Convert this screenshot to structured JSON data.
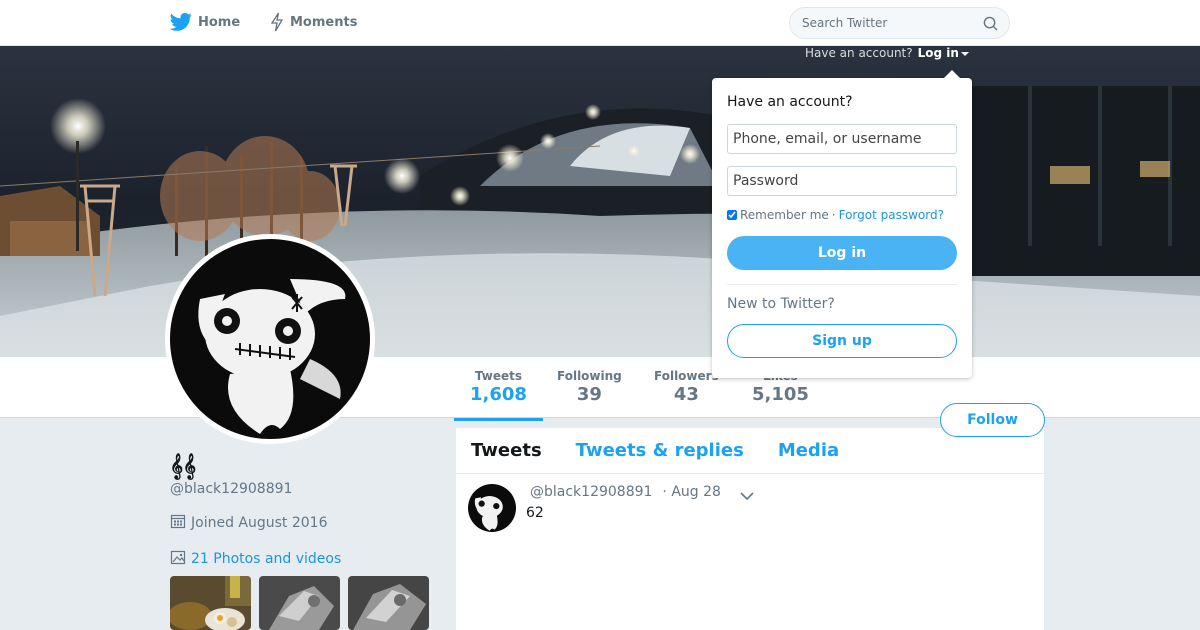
{
  "nav": {
    "home_label": "Home",
    "moments_label": "Moments",
    "search_placeholder": "Search Twitter",
    "have_account": "Have an account?",
    "login_label": "Log in"
  },
  "profile": {
    "name": "𝄞𝄞",
    "handle": "@black12908891",
    "joined": "Joined August 2016",
    "photos_link": "21 Photos and videos",
    "follow_label": "Follow"
  },
  "stats": [
    {
      "label": "Tweets",
      "value": "1,608"
    },
    {
      "label": "Following",
      "value": "39"
    },
    {
      "label": "Followers",
      "value": "43"
    },
    {
      "label": "Likes",
      "value": "5,105"
    }
  ],
  "timeline": {
    "tabs": [
      "Tweets",
      "Tweets & replies",
      "Media"
    ],
    "tweet": {
      "handle": "@black12908891",
      "time": "· Aug 28",
      "text": "62"
    }
  },
  "login_dropdown": {
    "title": "Have an account?",
    "username_placeholder": "Phone, email, or username",
    "password_placeholder": "Password",
    "remember_label": "Remember me",
    "separator": "·",
    "forgot_label": "Forgot password?",
    "login_button": "Log in",
    "new_label": "New to Twitter?",
    "signup_button": "Sign up"
  },
  "colors": {
    "accent": "#1da1f2",
    "login_button": "#4ab3f4",
    "page_background": "#e6ecf0"
  },
  "icons": [
    "twitter-bird-icon",
    "lightning-icon",
    "search-icon",
    "calendar-icon",
    "photo-icon",
    "chevron-down-icon"
  ]
}
